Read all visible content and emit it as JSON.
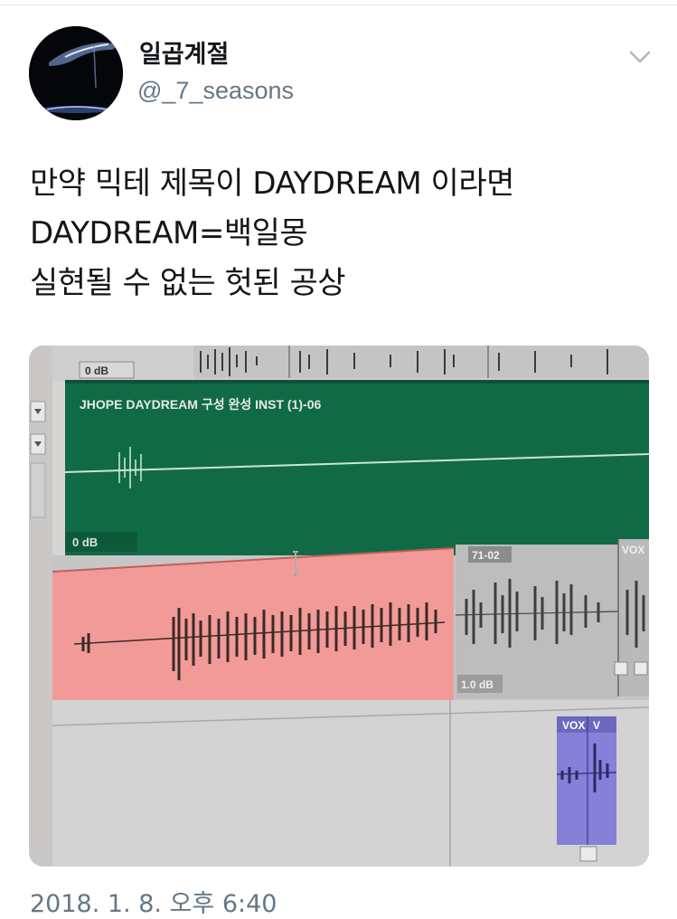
{
  "tweet": {
    "display_name": "일곱계절",
    "handle": "@_7_seasons",
    "text_lines": [
      "만약 믹테 제목이 DAYDREAM 이라면",
      "DAYDREAM=백일몽",
      "실현될 수 없는 헛된 공상"
    ],
    "timestamp": "2018. 1. 8. 오후 6:40"
  },
  "media": {
    "tracks": [
      {
        "name": "track-top",
        "gain": "0 dB"
      },
      {
        "name": "track-inst",
        "clip_label": "JHOPE DAYDREAM 구성 완성 INST (1)-06",
        "gain": "0 dB"
      },
      {
        "name": "track-vocal",
        "clip_label": "71-02",
        "gain": "1.0 dB",
        "extra_label": "VOX"
      },
      {
        "name": "track-bottom",
        "clip_labels": [
          "VOX",
          "V"
        ]
      }
    ]
  },
  "icons": {
    "caret": "chevron-down-icon",
    "avatar": "avatar-image"
  },
  "colors": {
    "text": "#14171a",
    "secondary": "#657786",
    "inst_clip": "#116a46",
    "vocal_clip": "#f08f8c",
    "vox_clip": "#8a82e0"
  }
}
